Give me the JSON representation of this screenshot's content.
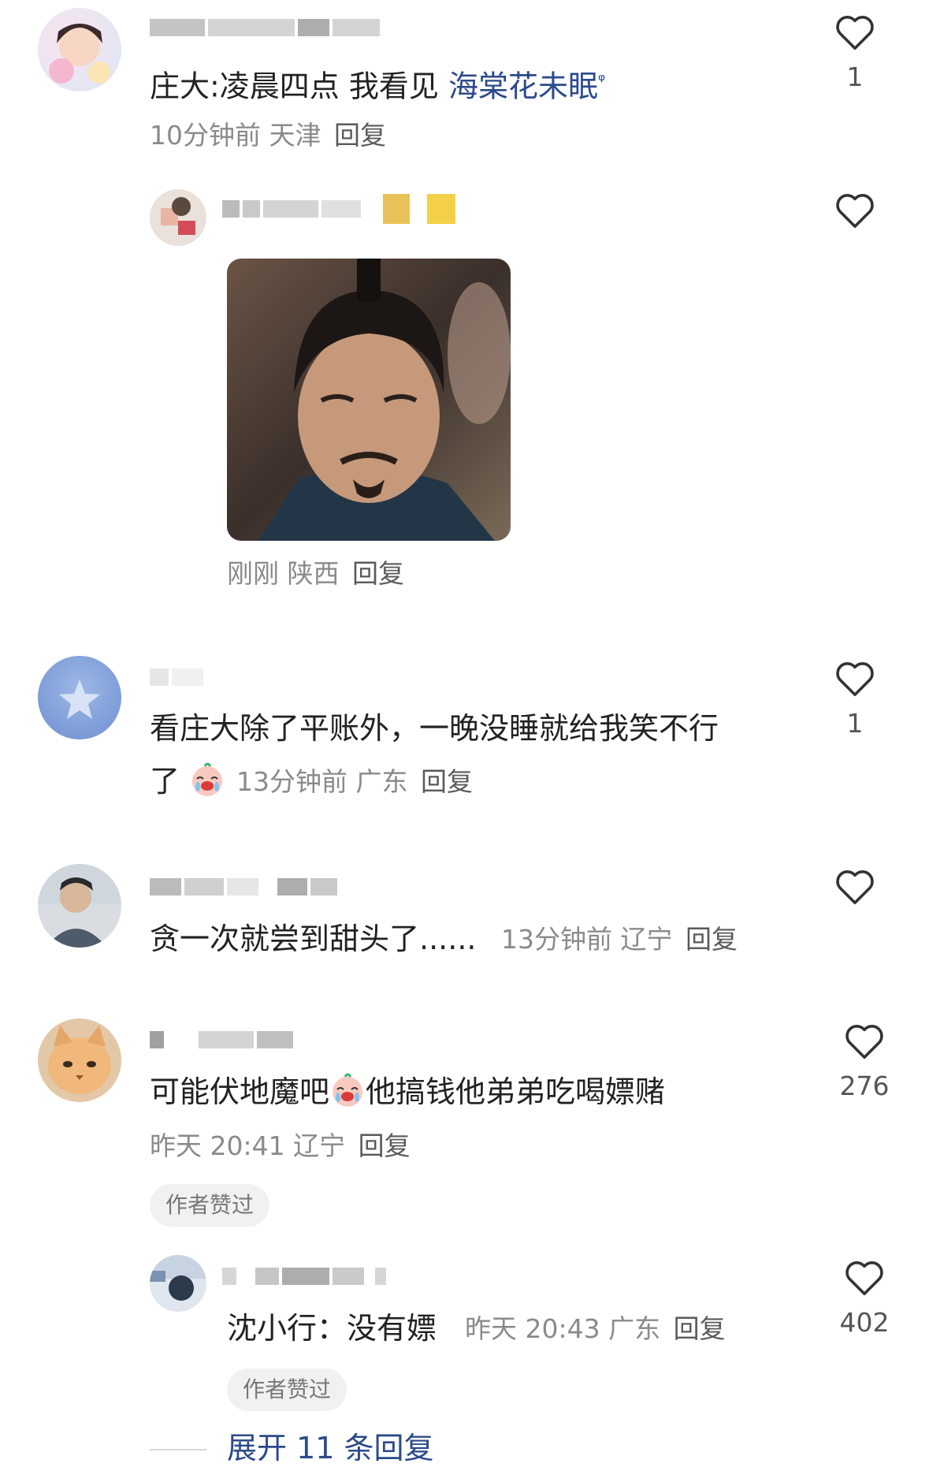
{
  "comments": [
    {
      "text_a": "庄大:凌晨四点 我看见 ",
      "text_link": "海棠花未眠",
      "search_mark": "ᵠ",
      "time": "10分钟前",
      "region": "天津",
      "reply": "回复",
      "likes": "1"
    },
    {
      "time": "刚刚",
      "region": "陕西",
      "reply": "回复"
    },
    {
      "line1": "看庄大除了平账外，一晚没睡就给我笑不行",
      "line2": "了",
      "time": "13分钟前",
      "region": "广东",
      "reply": "回复",
      "likes": "1"
    },
    {
      "text": "贪一次就尝到甜头了......",
      "time": "13分钟前",
      "region": "辽宁",
      "reply": "回复"
    },
    {
      "text_a": "可能伏地魔吧",
      "text_b": "他搞钱他弟弟吃喝嫖赌",
      "time": "昨天 20:41",
      "region": "辽宁",
      "reply": "回复",
      "likes": "276",
      "badge": "作者赞过"
    },
    {
      "text": "沈小行：没有嫖",
      "time": "昨天 20:43",
      "region": "广东",
      "reply": "回复",
      "likes": "402",
      "badge": "作者赞过"
    }
  ],
  "expand_replies": "展开 11 条回复",
  "colors": {
    "link": "#2b4a8a",
    "meta": "#8a8a8a",
    "heart": "#333333"
  }
}
